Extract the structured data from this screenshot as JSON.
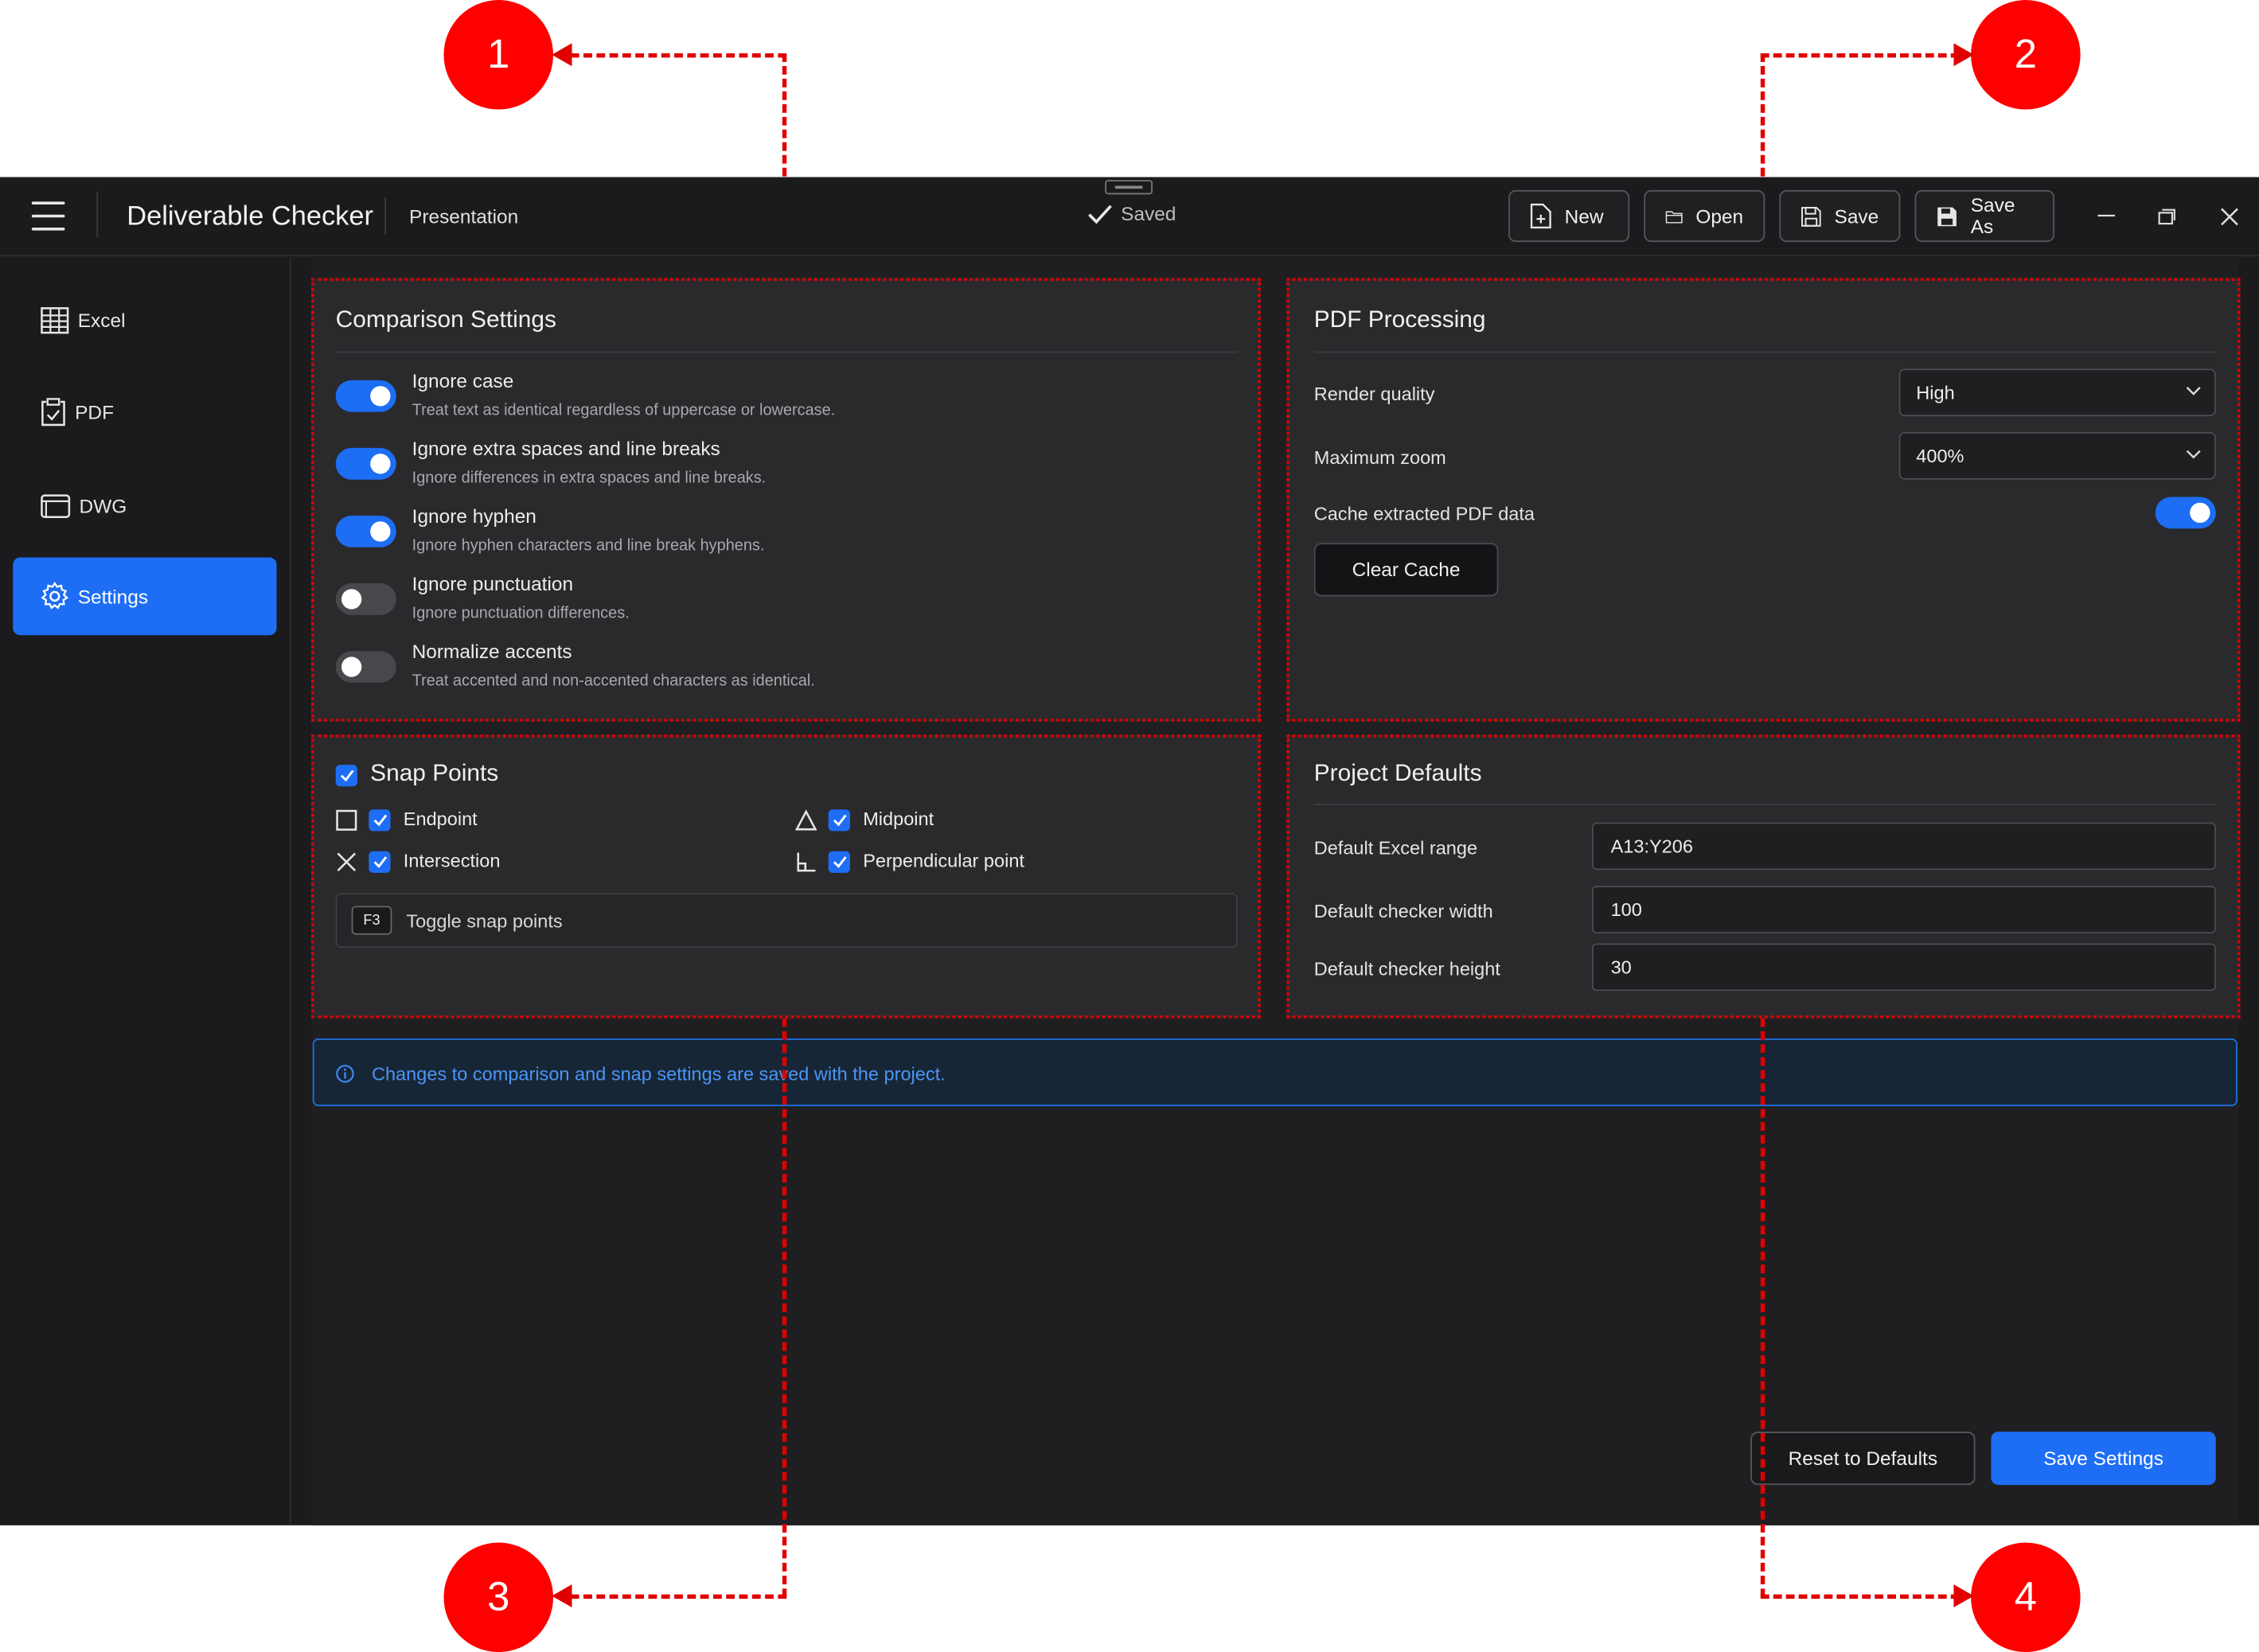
{
  "app": {
    "title": "Deliverable Checker",
    "subtitle": "Presentation",
    "status": "Saved"
  },
  "toolbar": {
    "new_label": "New",
    "open_label": "Open",
    "save_label": "Save",
    "save_as_label": "Save As"
  },
  "sidebar": {
    "items": [
      {
        "label": "Excel",
        "icon": "table-icon"
      },
      {
        "label": "PDF",
        "icon": "clipboard-icon"
      },
      {
        "label": "DWG",
        "icon": "window-icon"
      },
      {
        "label": "Settings",
        "icon": "gear-icon",
        "active": true
      }
    ]
  },
  "comparison": {
    "title": "Comparison Settings",
    "options": [
      {
        "label": "Ignore case",
        "desc": "Treat text as identical regardless of uppercase or lowercase.",
        "on": true
      },
      {
        "label": "Ignore extra spaces and line breaks",
        "desc": "Ignore differences in extra spaces and line breaks.",
        "on": true
      },
      {
        "label": "Ignore hyphen",
        "desc": "Ignore hyphen characters and line break hyphens.",
        "on": true
      },
      {
        "label": "Ignore punctuation",
        "desc": "Ignore punctuation differences.",
        "on": false
      },
      {
        "label": "Normalize accents",
        "desc": "Treat accented and non-accented characters as identical.",
        "on": false
      }
    ]
  },
  "pdf": {
    "title": "PDF Processing",
    "render_quality_label": "Render quality",
    "render_quality_value": "High",
    "max_zoom_label": "Maximum zoom",
    "max_zoom_value": "400%",
    "cache_label": "Cache extracted PDF data",
    "cache_on": true,
    "clear_cache_label": "Clear Cache"
  },
  "snap": {
    "title": "Snap Points",
    "enabled": true,
    "endpoint_label": "Endpoint",
    "midpoint_label": "Midpoint",
    "intersection_label": "Intersection",
    "perpendicular_label": "Perpendicular point",
    "shortcut_key": "F3",
    "shortcut_label": "Toggle snap points"
  },
  "defaults": {
    "title": "Project Defaults",
    "excel_range_label": "Default Excel range",
    "excel_range_value": "A13:Y206",
    "width_label": "Default checker width",
    "width_value": "100",
    "height_label": "Default checker height",
    "height_value": "30"
  },
  "info": {
    "text": "Changes to comparison and snap settings are saved with the project."
  },
  "footer": {
    "reset_label": "Reset to Defaults",
    "save_label": "Save Settings"
  },
  "callouts": [
    "1",
    "2",
    "3",
    "4"
  ],
  "colors": {
    "accent": "#1d6ef5",
    "callout": "#ff0000",
    "background": "#1b1b1d",
    "panel": "#2a2a2d"
  }
}
